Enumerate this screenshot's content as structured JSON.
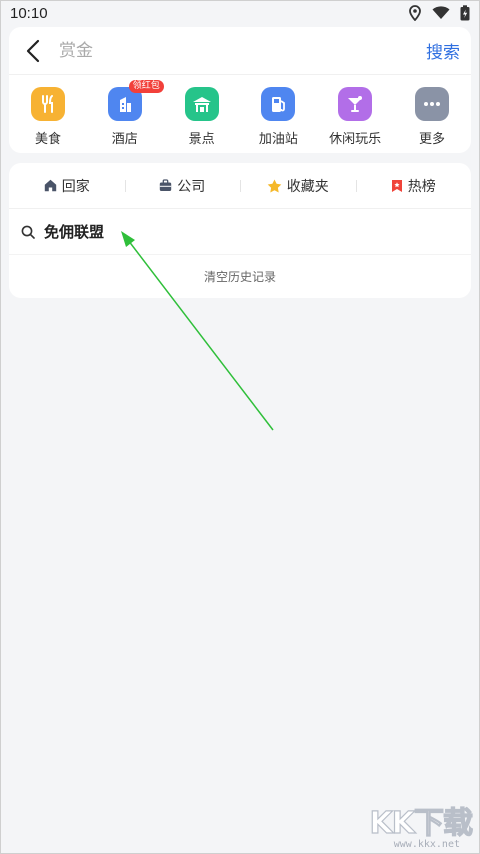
{
  "status_bar": {
    "time": "10:10"
  },
  "search": {
    "placeholder": "赏金",
    "button_label": "搜索"
  },
  "categories": [
    {
      "label": "美食",
      "icon": "fork-knife-icon",
      "color": "#f7b233"
    },
    {
      "label": "酒店",
      "icon": "hotel-building-icon",
      "color": "#4f86f0",
      "badge": "领红包"
    },
    {
      "label": "景点",
      "icon": "pavilion-icon",
      "color": "#26c48a"
    },
    {
      "label": "加油站",
      "icon": "fuel-pump-icon",
      "color": "#4f86f0"
    },
    {
      "label": "休闲玩乐",
      "icon": "cocktail-icon",
      "color": "#b26ee8"
    },
    {
      "label": "更多",
      "icon": "more-dots-icon",
      "color": "#8a93a6"
    }
  ],
  "quick_links": [
    {
      "label": "回家",
      "icon": "home-icon",
      "color": "#4a5468"
    },
    {
      "label": "公司",
      "icon": "briefcase-icon",
      "color": "#4a5468"
    },
    {
      "label": "收藏夹",
      "icon": "star-icon",
      "color": "#f5b82a"
    },
    {
      "label": "热榜",
      "icon": "ranking-bookmark-icon",
      "color": "#f0443a"
    }
  ],
  "history": [
    {
      "text": "免佣联盟"
    }
  ],
  "clear_history_label": "清空历史记录",
  "annotation": {
    "color": "#2fbf3a"
  },
  "watermark": {
    "logo": "KK下载",
    "url": "www.kkx.net"
  }
}
